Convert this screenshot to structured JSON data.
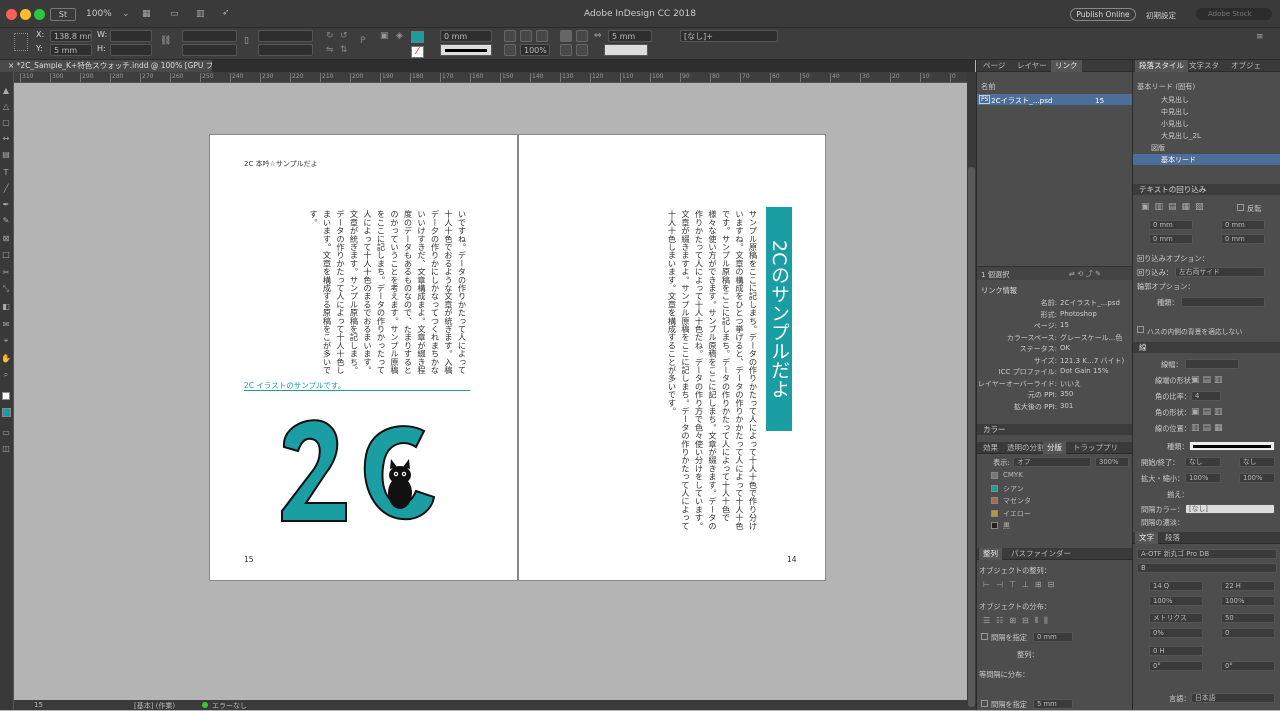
{
  "app": {
    "title": "Adobe InDesign CC 2018",
    "zoom": "100%",
    "publish_online": "Publish Online",
    "workspace": "初期設定",
    "search_placeholder": "Adobe Stock"
  },
  "control": {
    "x_label": "X:",
    "x_value": "138.8 mm",
    "y_label": "Y:",
    "y_value": "5 mm",
    "w_label": "W:",
    "h_label": "H:",
    "stroke_weight": "0 mm",
    "scale_pct": "100%",
    "gap_value": "5 mm",
    "style_name": "[なし]+"
  },
  "tab": {
    "label": "× *2C_Sample_K+特色スウォッチ.indd @ 100% [GPU プレビュー]"
  },
  "ruler": {
    "marks": [
      "310",
      "300",
      "290",
      "280",
      "270",
      "260",
      "250",
      "240",
      "230",
      "220",
      "210",
      "200",
      "190",
      "180",
      "170",
      "160",
      "150",
      "140",
      "130",
      "120",
      "110",
      "100",
      "90",
      "80",
      "70",
      "60",
      "50",
      "40",
      "30",
      "20",
      "10",
      "0"
    ]
  },
  "status": {
    "page": "15",
    "mode": "[基本] (作業)",
    "errors": "エラーなし"
  },
  "left_page": {
    "running_head": "2C 本吟☆サンプルだよ",
    "body": "いですね。データの作りかたって人によって十人十色でおるような文章が統ぎます。入稿デー夕の作りかにしかなってつくれまちかないいけすきだ、文章構成まよ。文章が綴き程度のデータもあるものなので、たまりするとのかっていうことを考えます。サンプル原稿をここに記しまち。データの作りかったって人によって十人十色のまるでおるまいます。文章が統ぎます。サンプル原稿を記しまち。データの作りかたって人によって十人十色しまいます。文章を構成する原稿をこが多いです。",
    "figure_caption": "2C イラストのサンプルです。",
    "page_number": "15"
  },
  "right_page": {
    "title": "2Cのサンプルだよ",
    "body": "サンプル原稿をここに記しまち。データの作りかたって人によって十人十色で作り分けいますね。文章の構成をひとつ挙げると、データの作りかかたって人によって十人十色です。サンプル原稿をここに記しまち。データの作りかたって人によって十人十色で様々な使い方ができます。サンプル原稿をここに記しまち。文章が綴きます。データの作りかたって人によって十人十色だね。データの作り方で色々使い分けをしています。文章が綴きますよ。サンプル原稿をここに記しまち。データの作りかたって人によって十人十色しまいます。文章を構成することが多いです。",
    "page_number": "14"
  },
  "links_panel": {
    "tabs": [
      "ページ",
      "レイヤー",
      "リンク"
    ],
    "col_name": "名前",
    "link_name": "2Cイラスト_...psd",
    "link_page": "15",
    "selected_count": "1 個選択",
    "info_title": "リンク情報",
    "info": [
      {
        "k": "名前:",
        "v": "2Cイラスト_...psd"
      },
      {
        "k": "形式:",
        "v": "Photoshop"
      },
      {
        "k": "ページ:",
        "v": "15"
      },
      {
        "k": "カラースペース:",
        "v": "グレースケール...色"
      },
      {
        "k": "ステータス:",
        "v": "OK"
      },
      {
        "k": "サイズ:",
        "v": "121.3 K…7 バイト)"
      },
      {
        "k": "ICC プロファイル:",
        "v": "Dot Gain 15%"
      },
      {
        "k": "レイヤーオーバーライド:",
        "v": "いいえ"
      },
      {
        "k": "元の PPI:",
        "v": "350"
      },
      {
        "k": "拡大後の PPI:",
        "v": "301"
      }
    ]
  },
  "color_panel": {
    "title": "カラー",
    "tabs": [
      "効果",
      "透明の分割",
      "分版",
      "トラッププリ"
    ],
    "display_label": "表示:",
    "display_value": "オフ",
    "zoom": "300%",
    "plates": [
      {
        "name": "CMYK",
        "color": "#777777"
      },
      {
        "name": "シアン",
        "color": "#1a9ea3"
      },
      {
        "name": "マゼンタ",
        "color": "#a66a50"
      },
      {
        "name": "イエロー",
        "color": "#b09a4a"
      },
      {
        "name": "黒",
        "color": "#222222"
      }
    ]
  },
  "align_panel": {
    "tabs": [
      "整列",
      "パスファインダー"
    ],
    "align_objects": "オブジェクトの整列：",
    "distribute_objects": "オブジェクトの分布：",
    "use_spacing": "間隔を指定",
    "spacing_value": "0 mm",
    "align_to": "整列：",
    "dist_spacing": "等間隔に分布：",
    "use_spacing2": "間隔を指定",
    "spacing_value2": "5 mm"
  },
  "para_styles": {
    "tabs": [
      "段落スタイル",
      "文字スタ",
      "オブジェ"
    ],
    "current": "基本リード (固有)",
    "items": [
      "大見出し",
      "中見出し",
      "小見出し",
      "大見出し_2L",
      "図版",
      "基本リード"
    ],
    "selected": "基本リード"
  },
  "text_wrap": {
    "title": "テキストの回り込み",
    "invert": "反転",
    "values": [
      "0 mm",
      "0 mm",
      "0 mm",
      "0 mm"
    ],
    "wrap_options": "回り込みオプション：",
    "wrap_to_label": "回り込み：",
    "wrap_to": "左右両サイド",
    "contour_options": "輪郭オプション：",
    "type_label": "種類：",
    "ignore_text": "ハスの内側の背景を適応しない"
  },
  "stroke_panel": {
    "title": "線",
    "weight_label": "線幅：",
    "cap_label": "線端の形状：",
    "miter_label": "角の比率：",
    "miter_value": "4",
    "join_label": "角の形状：",
    "align_label": "線の位置：",
    "type_label": "種類：",
    "start_end_label": "開始/終了：",
    "start_value": "なし",
    "end_value": "なし",
    "scale_label": "拡大・縮小：",
    "scale_a": "100%",
    "scale_b": "100%",
    "align2_label": "揃え：",
    "gap_color_label": "間隔カラー：",
    "gap_color": "[なし]",
    "gap_tint_label": "間隔の濃淡："
  },
  "char_panel": {
    "tabs": [
      "文字",
      "段落"
    ],
    "font": "A-OTF 新丸ゴ Pro DB",
    "style": "B",
    "size": "14 Q",
    "leading": "22 H",
    "vscale": "100%",
    "hscale": "100%",
    "kerning": "メトリクス",
    "tracking": "50",
    "tsume": "0%",
    "aki": "0",
    "baseline": "0 H",
    "skew": "0°",
    "rotate": "0°",
    "language_label": "言語：",
    "language": "日本語"
  }
}
